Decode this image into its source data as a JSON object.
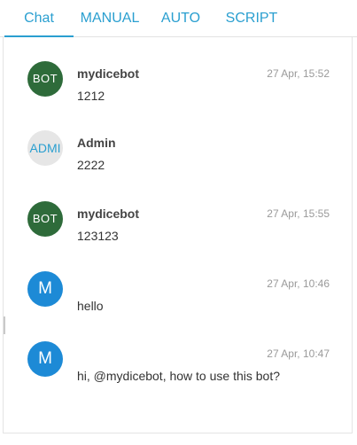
{
  "tabs": [
    {
      "label": "Chat",
      "active": true
    },
    {
      "label": "MANUAL",
      "active": false
    },
    {
      "label": "AUTO",
      "active": false
    },
    {
      "label": "SCRIPT",
      "active": false
    }
  ],
  "colors": {
    "accent": "#2a9fd0",
    "bot_avatar": "#2e6b3a",
    "user_avatar": "#1d8ad6",
    "admin_avatar_bg": "#e6e6e6"
  },
  "messages": [
    {
      "avatar": "BOT",
      "name": "mydicebot",
      "time": "27 Apr, 15:52",
      "text": "1212"
    },
    {
      "avatar": "ADMI",
      "name": "Admin",
      "time": "",
      "text": "2222"
    },
    {
      "avatar": "BOT",
      "name": "mydicebot",
      "time": "27 Apr, 15:55",
      "text": "123123"
    },
    {
      "avatar": "M",
      "name": "",
      "time": "27 Apr, 10:46",
      "text": "hello"
    },
    {
      "avatar": "M",
      "name": "",
      "time": "27 Apr, 10:47",
      "text": "hi, @mydicebot, how to use this bot?"
    }
  ]
}
